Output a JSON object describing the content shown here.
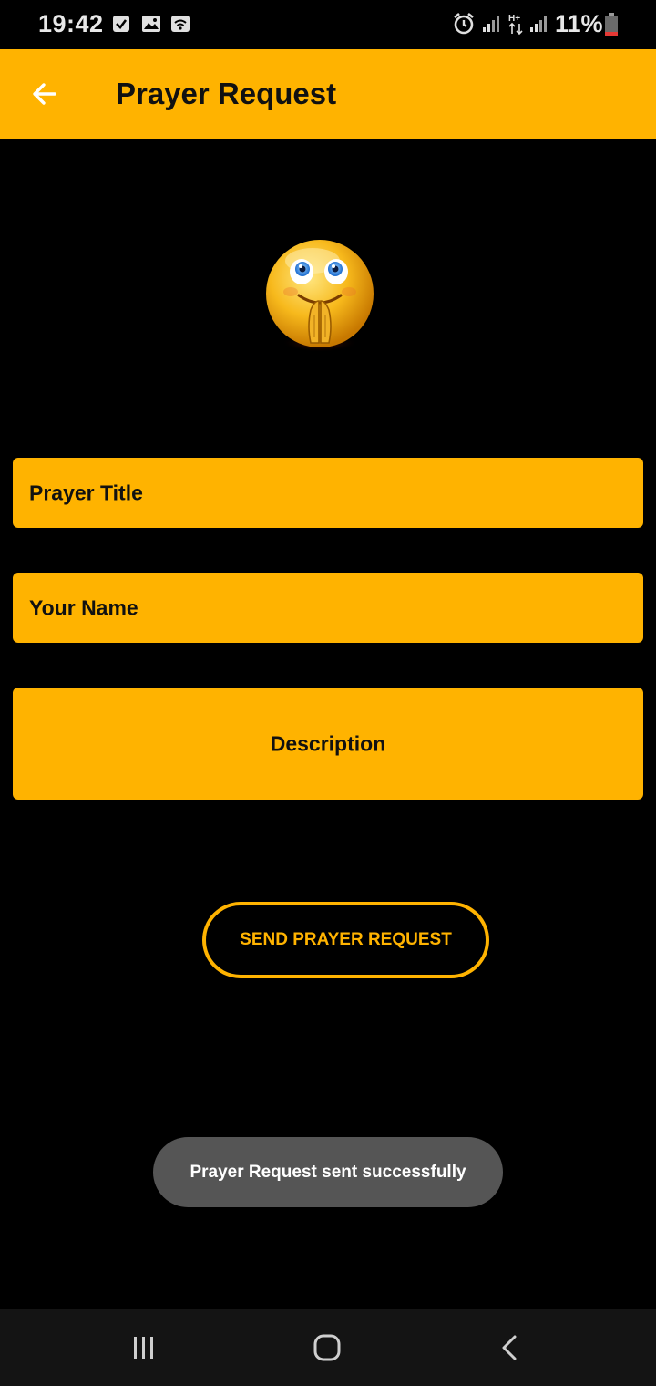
{
  "status_bar": {
    "time": "19:42",
    "battery_percent": "11%",
    "icons": [
      "checkbox-icon",
      "image-icon",
      "wifi-call-icon",
      "alarm-icon",
      "signal-icon",
      "hplus-icon",
      "signal-icon",
      "battery-icon"
    ]
  },
  "app_bar": {
    "title": "Prayer Request",
    "back_icon": "arrow-left-icon"
  },
  "form": {
    "prayer_title_placeholder": "Prayer Title",
    "your_name_placeholder": "Your Name",
    "description_placeholder": "Description",
    "send_label": "SEND PRAYER REQUEST"
  },
  "toast": {
    "message": "Prayer Request sent successfully"
  },
  "nav_bar": {
    "icons": [
      "recents-icon",
      "home-icon",
      "back-icon"
    ]
  },
  "colors": {
    "accent": "#FFB300",
    "background": "#000000",
    "toast_bg": "#555555",
    "nav_bg": "#141414"
  }
}
